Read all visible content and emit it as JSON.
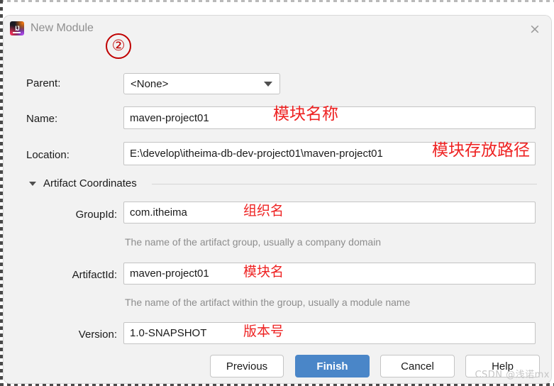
{
  "window": {
    "title": "New Module",
    "app_icon": "intellij-idea-icon",
    "icon_letters": "IJ",
    "close_label": "×"
  },
  "annotations": {
    "step_number": "②",
    "name_note": "模块名称",
    "location_note": "模块存放路径",
    "groupid_note": "组织名",
    "artifactid_note": "模块名",
    "version_note": "版本号"
  },
  "form": {
    "parent": {
      "label": "Parent:",
      "value": "<None>",
      "caret_icon": "chevron-down-icon"
    },
    "name": {
      "label": "Name:",
      "value": "maven-project01"
    },
    "location": {
      "label": "Location:",
      "value": "E:\\develop\\itheima-db-dev-project01\\maven-project01"
    }
  },
  "artifact_section": {
    "title": "Artifact Coordinates",
    "expander_icon": "triangle-down-icon",
    "fields": {
      "groupid": {
        "label": "GroupId:",
        "value": "com.itheima",
        "hint": "The name of the artifact group, usually a company domain"
      },
      "artifactid": {
        "label": "ArtifactId:",
        "value": "maven-project01",
        "hint": "The name of the artifact within the group, usually a module name"
      },
      "version": {
        "label": "Version:",
        "value": "1.0-SNAPSHOT"
      }
    }
  },
  "buttons": {
    "previous": "Previous",
    "finish": "Finish",
    "cancel": "Cancel",
    "help": "Help"
  },
  "watermark": "CSDN @浅诺mx",
  "colors": {
    "primary_button": "#4a86c8",
    "annotation_red": "#ee2222",
    "circle_red": "#c00000",
    "dialog_bg": "#f2f2f2",
    "field_border": "#c4c4c4"
  }
}
